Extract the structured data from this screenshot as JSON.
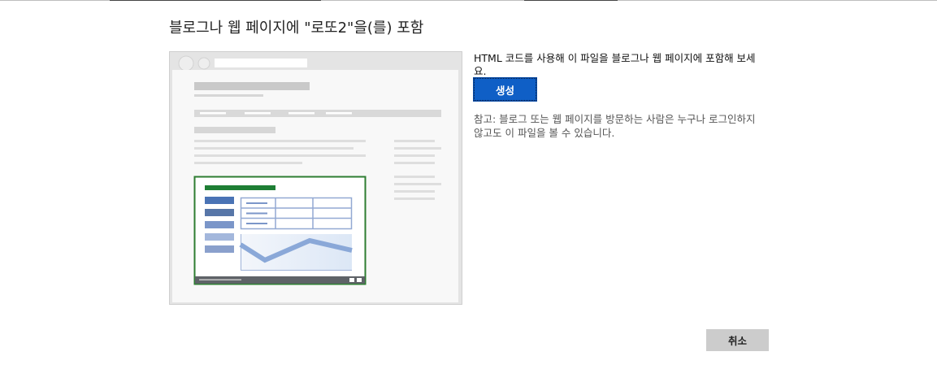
{
  "dialog": {
    "title": "블로그나 웹 페이지에 \"로또2\"을(를) 포함",
    "description": "HTML 코드를 사용해 이 파일을 블로그나 웹 페이지에 포함해 보세요.",
    "generate_label": "생성",
    "note": "참고: 블로그 또는 웹 페이지를 방문하는 사람은 누구나 로그인하지 않고도 이 파일을 볼 수 있습니다.",
    "cancel_label": "취소"
  },
  "illustration": {
    "icon": "embedded-spreadsheet-webpage-illustration",
    "colors": {
      "frame": "#e6e6e6",
      "page": "#f7f7f7",
      "placeholder": "#d3d3d3",
      "embed_border": "#2e7d32",
      "embed_header": "#1e7e34",
      "table_blue": "#4a73b5",
      "chart_blue": "#8aa8d8",
      "footer_bar": "#5f6368"
    }
  },
  "colors": {
    "accent": "#0f5fc6",
    "cancel_bg": "#cccccc"
  }
}
